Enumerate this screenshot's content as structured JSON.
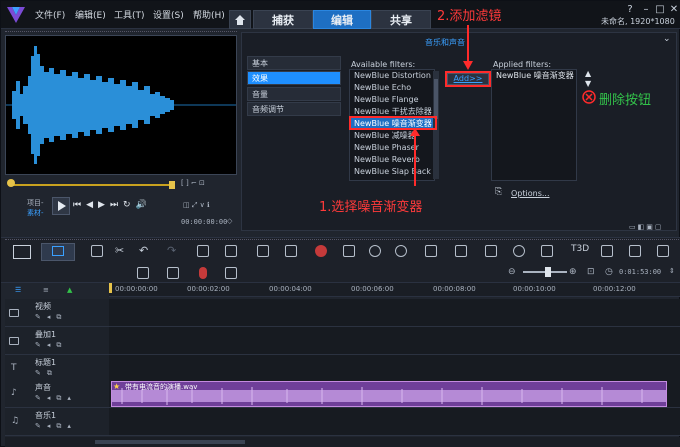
{
  "menu": [
    "文件(F)",
    "编辑(E)",
    "工具(T)",
    "设置(S)",
    "帮助(H)"
  ],
  "tabs": {
    "capture": "捕获",
    "edit": "编辑",
    "share": "共享"
  },
  "window": {
    "title": "未命名, 1920*1080"
  },
  "annotations": {
    "step1": "1.选择噪音渐变器",
    "step2": "2.添加滤镜",
    "delete": "删除按钮"
  },
  "preview": {
    "project_label": "项目-",
    "clip_label": "素材-",
    "timecode": "00:00:00:00"
  },
  "options": {
    "heading": "音乐和声音",
    "categories": [
      "基本",
      "效果",
      "音量",
      "音频调节"
    ],
    "selected_category": "效果",
    "available_label": "Available filters:",
    "available_filters": [
      "NewBlue Distortion",
      "NewBlue Echo",
      "NewBlue Flange",
      "NewBlue 干扰去除器",
      "NewBlue 噪音渐变器",
      "NewBlue 减噪器",
      "NewBlue Phaser",
      "NewBlue Reverb",
      "NewBlue Slap Back"
    ],
    "selected_filter": "NewBlue 噪音渐变器",
    "add_button": "Add>>",
    "applied_label": "Applied filters:",
    "applied_filters": [
      "NewBlue 噪音渐变器"
    ],
    "options_button": "Options..."
  },
  "timeline": {
    "timecode": "0:01:53:00",
    "ruler_ticks": [
      "00:00:00:00",
      "00:00:02:00",
      "00:00:04:00",
      "00:00:06:00",
      "00:00:08:00",
      "00:00:10:00",
      "00:00:12:00"
    ],
    "tracks": [
      "视频",
      "叠加1",
      "标题1",
      "声音",
      "音乐1"
    ],
    "clip_name": "带有电流音的演播.wav"
  }
}
